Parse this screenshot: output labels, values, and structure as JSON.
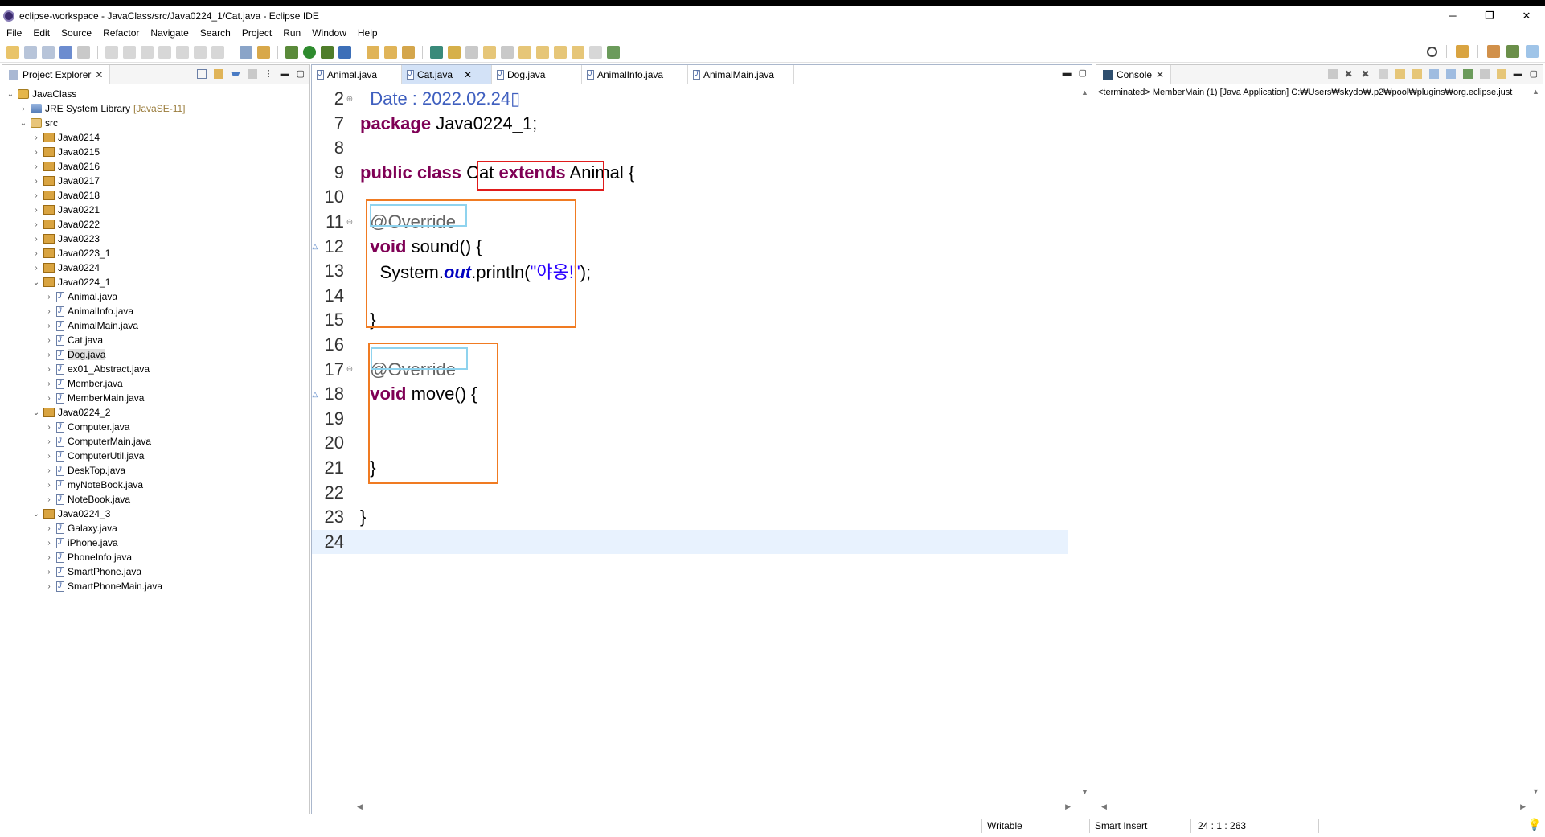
{
  "window": {
    "title": "eclipse-workspace - JavaClass/src/Java0224_1/Cat.java - Eclipse IDE",
    "minimize": "─",
    "maximize": "❐",
    "close": "✕"
  },
  "menu": [
    "File",
    "Edit",
    "Source",
    "Refactor",
    "Navigate",
    "Search",
    "Project",
    "Run",
    "Window",
    "Help"
  ],
  "explorer": {
    "tab_label": "Project Explorer",
    "tree": [
      {
        "label": "JavaClass",
        "level": 0,
        "icon": "project-icon",
        "expanded": true
      },
      {
        "label": "JRE System Library",
        "suffix": "[JavaSE-11]",
        "level": 1,
        "icon": "library-icon",
        "expanded": false
      },
      {
        "label": "src",
        "level": 1,
        "icon": "source-folder-icon",
        "expanded": true
      },
      {
        "label": "Java0214",
        "level": 2,
        "icon": "package-icon",
        "expanded": false
      },
      {
        "label": "Java0215",
        "level": 2,
        "icon": "package-icon",
        "expanded": false
      },
      {
        "label": "Java0216",
        "level": 2,
        "icon": "package-icon",
        "expanded": false
      },
      {
        "label": "Java0217",
        "level": 2,
        "icon": "package-icon",
        "expanded": false
      },
      {
        "label": "Java0218",
        "level": 2,
        "icon": "package-icon",
        "expanded": false
      },
      {
        "label": "Java0221",
        "level": 2,
        "icon": "package-icon",
        "expanded": false
      },
      {
        "label": "Java0222",
        "level": 2,
        "icon": "package-icon",
        "expanded": false
      },
      {
        "label": "Java0223",
        "level": 2,
        "icon": "package-icon",
        "expanded": false
      },
      {
        "label": "Java0223_1",
        "level": 2,
        "icon": "package-icon",
        "expanded": false
      },
      {
        "label": "Java0224",
        "level": 2,
        "icon": "package-icon",
        "expanded": false
      },
      {
        "label": "Java0224_1",
        "level": 2,
        "icon": "package-icon",
        "expanded": true
      },
      {
        "label": "Animal.java",
        "level": 3,
        "icon": "java-file-icon",
        "expanded": false
      },
      {
        "label": "AnimalInfo.java",
        "level": 3,
        "icon": "java-file-icon",
        "expanded": false
      },
      {
        "label": "AnimalMain.java",
        "level": 3,
        "icon": "java-file-icon",
        "expanded": false
      },
      {
        "label": "Cat.java",
        "level": 3,
        "icon": "java-file-icon",
        "expanded": false
      },
      {
        "label": "Dog.java",
        "level": 3,
        "icon": "java-file-icon",
        "expanded": false,
        "selected": true
      },
      {
        "label": "ex01_Abstract.java",
        "level": 3,
        "icon": "java-file-icon",
        "expanded": false
      },
      {
        "label": "Member.java",
        "level": 3,
        "icon": "java-file-icon",
        "expanded": false
      },
      {
        "label": "MemberMain.java",
        "level": 3,
        "icon": "java-file-icon",
        "expanded": false
      },
      {
        "label": "Java0224_2",
        "level": 2,
        "icon": "package-icon",
        "expanded": true
      },
      {
        "label": "Computer.java",
        "level": 3,
        "icon": "java-file-icon",
        "expanded": false
      },
      {
        "label": "ComputerMain.java",
        "level": 3,
        "icon": "java-file-icon",
        "expanded": false
      },
      {
        "label": "ComputerUtil.java",
        "level": 3,
        "icon": "java-file-icon",
        "expanded": false
      },
      {
        "label": "DeskTop.java",
        "level": 3,
        "icon": "java-file-icon",
        "expanded": false
      },
      {
        "label": "myNoteBook.java",
        "level": 3,
        "icon": "java-file-icon",
        "expanded": false
      },
      {
        "label": "NoteBook.java",
        "level": 3,
        "icon": "java-file-icon",
        "expanded": false
      },
      {
        "label": "Java0224_3",
        "level": 2,
        "icon": "package-icon",
        "expanded": true
      },
      {
        "label": "Galaxy.java",
        "level": 3,
        "icon": "java-file-icon",
        "expanded": false
      },
      {
        "label": "iPhone.java",
        "level": 3,
        "icon": "java-file-icon",
        "expanded": false
      },
      {
        "label": "PhoneInfo.java",
        "level": 3,
        "icon": "java-file-icon",
        "expanded": false
      },
      {
        "label": "SmartPhone.java",
        "level": 3,
        "icon": "java-file-icon",
        "expanded": false
      },
      {
        "label": "SmartPhoneMain.java",
        "level": 3,
        "icon": "java-file-icon",
        "expanded": false
      }
    ]
  },
  "editor": {
    "tabs": [
      {
        "label": "Animal.java",
        "active": false
      },
      {
        "label": "Cat.java",
        "active": true
      },
      {
        "label": "Dog.java",
        "active": false
      },
      {
        "label": "AnimalInfo.java",
        "active": false
      },
      {
        "label": "AnimalMain.java",
        "active": false
      }
    ],
    "lines": [
      {
        "num": "2",
        "fold": "⊕",
        "text": "  Date : 2022.02.24▯"
      },
      {
        "num": "7",
        "text": "package Java0224_1;"
      },
      {
        "num": "8",
        "text": ""
      },
      {
        "num": "9",
        "text": "public class Cat extends Animal {"
      },
      {
        "num": "10",
        "text": ""
      },
      {
        "num": "11",
        "fold": "⊖",
        "text": "  @Override"
      },
      {
        "num": "12",
        "marker": "△",
        "text": "  void sound() {"
      },
      {
        "num": "13",
        "text": "    System.out.println(\"야옹!\");"
      },
      {
        "num": "14",
        "text": ""
      },
      {
        "num": "15",
        "text": "  }"
      },
      {
        "num": "16",
        "text": ""
      },
      {
        "num": "17",
        "fold": "⊖",
        "text": "  @Override"
      },
      {
        "num": "18",
        "marker": "△",
        "text": "  void move() {"
      },
      {
        "num": "19",
        "text": ""
      },
      {
        "num": "20",
        "text": ""
      },
      {
        "num": "21",
        "text": "  }"
      },
      {
        "num": "22",
        "text": ""
      },
      {
        "num": "23",
        "text": "}"
      },
      {
        "num": "24",
        "text": ""
      }
    ]
  },
  "console": {
    "tab_label": "Console",
    "text": "<terminated> MemberMain (1) [Java Application] C:₩Users₩skydo₩.p2₩pool₩plugins₩org.eclipse.just"
  },
  "status": {
    "writable": "Writable",
    "insert_mode": "Smart Insert",
    "position": "24 : 1 : 263"
  },
  "colors": {
    "keyword": "#7f0055",
    "annotation": "#646464",
    "comment": "#3f5fbf",
    "string": "#2a00ff",
    "highlight_red": "#e01b1b",
    "highlight_orange": "#f07b22",
    "highlight_cyan": "#8fd3ee",
    "active_tab": "#d3e2f7"
  }
}
